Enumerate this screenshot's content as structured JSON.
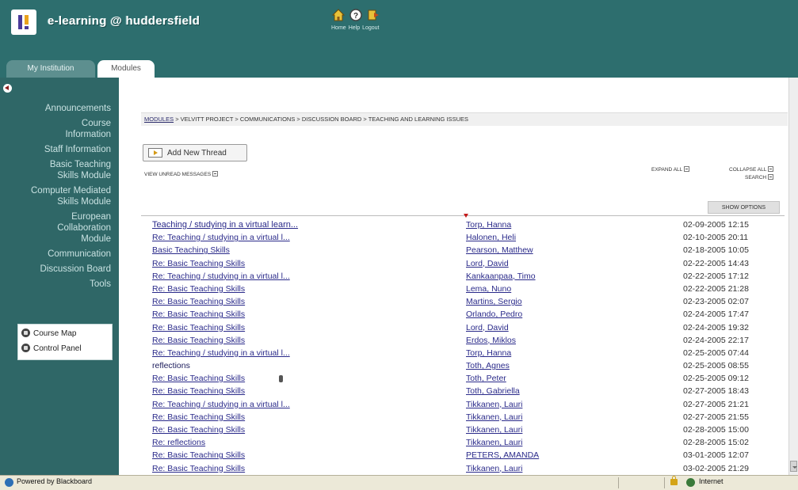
{
  "header": {
    "brand": "e-learning @ huddersfield",
    "links": [
      "Home",
      "Help",
      "Logout"
    ]
  },
  "tabs": [
    {
      "label": "My Institution",
      "active": false
    },
    {
      "label": "Modules",
      "active": true
    }
  ],
  "sidebar": {
    "items": [
      "Announcements",
      "Course Information",
      "Staff Information",
      "Basic Teaching Skills Module",
      "Computer Mediated Skills Module",
      "European Collaboration Module",
      "Communication",
      "Discussion Board",
      "Tools"
    ],
    "tools": {
      "course_map": "Course Map",
      "control_panel": "Control Panel"
    }
  },
  "breadcrumb": {
    "link": "MODULES",
    "rest": "> VELVITT PROJECT > COMMUNICATIONS > DISCUSSION BOARD > TEACHING AND LEARNING ISSUES"
  },
  "toolbar": {
    "add_thread": "Add New Thread",
    "view_unread": "VIEW UNREAD MESSAGES",
    "expand_all": "EXPAND ALL",
    "collapse_all": "COLLAPSE ALL",
    "search": "SEARCH",
    "show_options": "SHOW OPTIONS"
  },
  "threads": [
    {
      "subject": "Teaching / studying in a virtual learn...",
      "author": "Torp, Hanna",
      "date": "02-09-2005 12:15"
    },
    {
      "subject": "Re: Teaching / studying in a virtual l...",
      "author": "Halonen, Heli",
      "date": "02-10-2005 20:11"
    },
    {
      "subject": "Basic Teaching Skills",
      "author": "Pearson, Matthew",
      "date": "02-18-2005 10:05"
    },
    {
      "subject": "Re: Basic Teaching Skills",
      "author": "Lord, David",
      "date": "02-22-2005 14:43"
    },
    {
      "subject": "Re: Teaching / studying in a virtual l...",
      "author": "Kankaanpaa, Timo",
      "date": "02-22-2005 17:12"
    },
    {
      "subject": "Re: Basic Teaching Skills",
      "author": "Lema, Nuno",
      "date": "02-22-2005 21:28"
    },
    {
      "subject": "Re: Basic Teaching Skills",
      "author": "Martins, Sergio",
      "date": "02-23-2005 02:07"
    },
    {
      "subject": "Re: Basic Teaching Skills",
      "author": "Orlando, Pedro",
      "date": "02-24-2005 17:47"
    },
    {
      "subject": "Re: Basic Teaching Skills",
      "author": "Lord, David",
      "date": "02-24-2005 19:32"
    },
    {
      "subject": "Re: Basic Teaching Skills",
      "author": "Erdos, Miklos",
      "date": "02-24-2005 22:17"
    },
    {
      "subject": "Re: Teaching / studying in a virtual l...",
      "author": "Torp, Hanna",
      "date": "02-25-2005 07:44"
    },
    {
      "subject": "reflections",
      "author": "Toth, Agnes",
      "date": "02-25-2005 08:55"
    },
    {
      "subject": "Re: Basic Teaching Skills",
      "author": "Toth, Peter",
      "date": "02-25-2005 09:12",
      "attachment": true
    },
    {
      "subject": "Re: Basic Teaching Skills",
      "author": "Toth, Gabriella",
      "date": "02-27-2005 18:43"
    },
    {
      "subject": "Re: Teaching / studying in a virtual l...",
      "author": "Tikkanen, Lauri",
      "date": "02-27-2005 21:21"
    },
    {
      "subject": "Re: Basic Teaching Skills",
      "author": "Tikkanen, Lauri",
      "date": "02-27-2005 21:55"
    },
    {
      "subject": "Re: Basic Teaching Skills",
      "author": "Tikkanen, Lauri",
      "date": "02-28-2005 15:00"
    },
    {
      "subject": "Re: reflections",
      "author": "Tikkanen, Lauri",
      "date": "02-28-2005 15:02"
    },
    {
      "subject": "Re: Basic Teaching Skills",
      "author": "PETERS, AMANDA",
      "date": "03-01-2005 12:07"
    },
    {
      "subject": "Re: Basic Teaching Skills",
      "author": "Tikkanen, Lauri",
      "date": "03-02-2005 21:29"
    }
  ],
  "statusbar": {
    "left": "Powered by Blackboard",
    "zone": "Internet"
  },
  "colors": {
    "header_bg": "#2d6e6e",
    "sidebar_bg": "#2f6767",
    "link": "#2a2a8a"
  }
}
